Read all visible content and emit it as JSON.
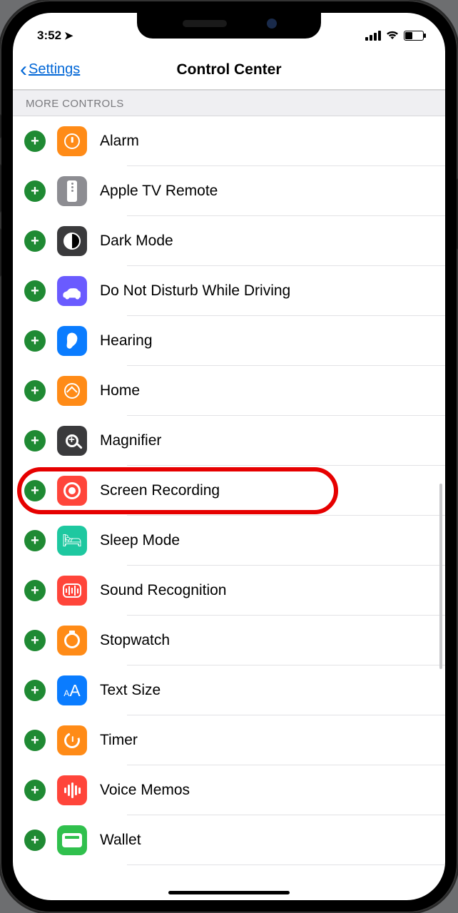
{
  "status": {
    "time": "3:52"
  },
  "nav": {
    "back_label": "Settings",
    "title": "Control Center"
  },
  "section": {
    "header": "MORE CONTROLS"
  },
  "controls": [
    {
      "label": "Alarm",
      "icon": "alarm-icon",
      "color": "ic-orange"
    },
    {
      "label": "Apple TV Remote",
      "icon": "apple-tv-remote-icon",
      "color": "ic-grey"
    },
    {
      "label": "Dark Mode",
      "icon": "dark-mode-icon",
      "color": "ic-darkgrey"
    },
    {
      "label": "Do Not Disturb While Driving",
      "icon": "dnd-driving-icon",
      "color": "ic-purple"
    },
    {
      "label": "Hearing",
      "icon": "hearing-icon",
      "color": "ic-blue"
    },
    {
      "label": "Home",
      "icon": "home-icon",
      "color": "ic-orange"
    },
    {
      "label": "Magnifier",
      "icon": "magnifier-icon",
      "color": "ic-darkgrey"
    },
    {
      "label": "Screen Recording",
      "icon": "screen-recording-icon",
      "color": "ic-red",
      "highlighted": true
    },
    {
      "label": "Sleep Mode",
      "icon": "sleep-mode-icon",
      "color": "ic-teal"
    },
    {
      "label": "Sound Recognition",
      "icon": "sound-recognition-icon",
      "color": "ic-red"
    },
    {
      "label": "Stopwatch",
      "icon": "stopwatch-icon",
      "color": "ic-orange"
    },
    {
      "label": "Text Size",
      "icon": "text-size-icon",
      "color": "ic-blue"
    },
    {
      "label": "Timer",
      "icon": "timer-icon",
      "color": "ic-orange"
    },
    {
      "label": "Voice Memos",
      "icon": "voice-memos-icon",
      "color": "ic-red"
    },
    {
      "label": "Wallet",
      "icon": "wallet-icon",
      "color": "ic-green"
    }
  ]
}
